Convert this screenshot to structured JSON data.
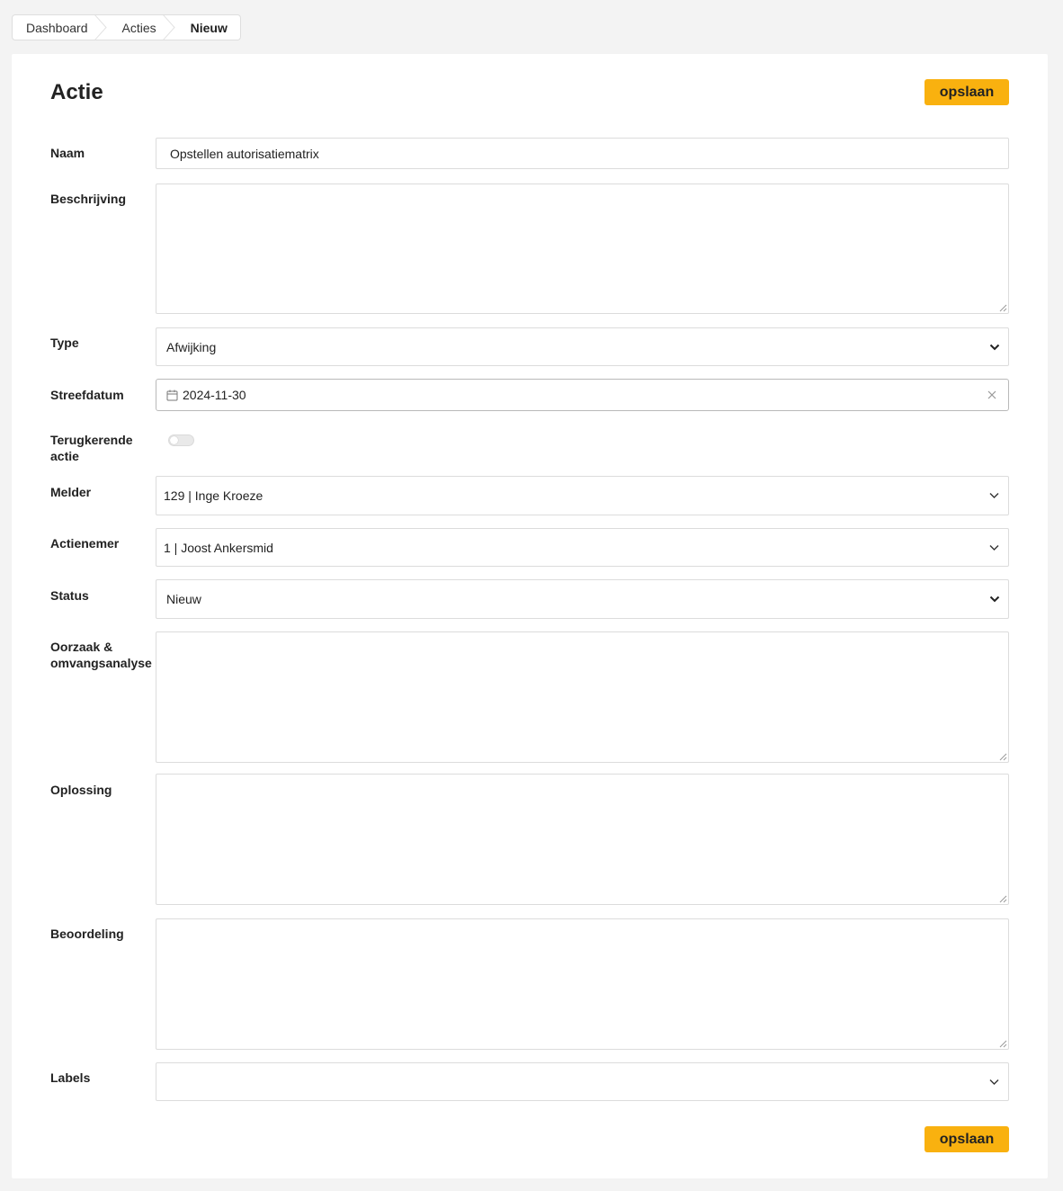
{
  "breadcrumb": {
    "items": [
      "Dashboard",
      "Acties",
      "Nieuw"
    ]
  },
  "page": {
    "title": "Actie",
    "save_label": "opslaan"
  },
  "form": {
    "naam": {
      "label": "Naam",
      "value": "Opstellen autorisatiematrix"
    },
    "beschrijving": {
      "label": "Beschrijving",
      "value": ""
    },
    "type": {
      "label": "Type",
      "value": "Afwijking"
    },
    "streefdatum": {
      "label": "Streefdatum",
      "value": "2024-11-30"
    },
    "terugkerend": {
      "label": "Terugkerende actie",
      "checked": false
    },
    "melder": {
      "label": "Melder",
      "value": "129 | Inge Kroeze"
    },
    "actienemer": {
      "label": "Actienemer",
      "value": "1 | Joost Ankersmid"
    },
    "status": {
      "label": "Status",
      "value": "Nieuw"
    },
    "oorzaak": {
      "label": "Oorzaak & omvangsanalyse",
      "value": ""
    },
    "oplossing": {
      "label": "Oplossing",
      "value": ""
    },
    "beoordeling": {
      "label": "Beoordeling",
      "value": ""
    },
    "labels": {
      "label": "Labels",
      "value": ""
    }
  },
  "colors": {
    "accent": "#f9b10f",
    "background": "#f3f3f3",
    "card": "#ffffff",
    "border": "#dcdcdc"
  }
}
